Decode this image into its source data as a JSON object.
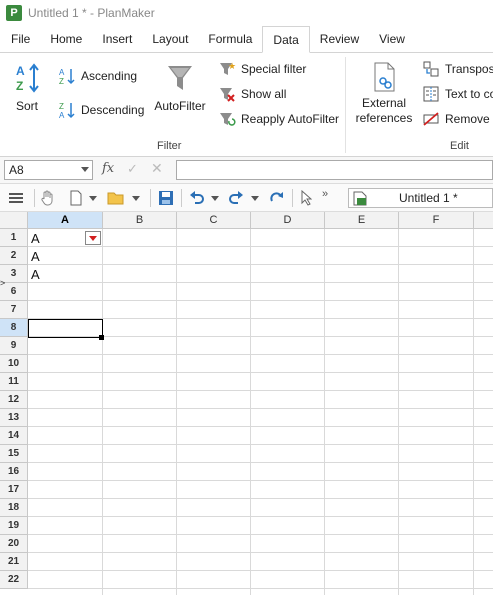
{
  "window": {
    "title": "Untitled 1 * - PlanMaker",
    "app_icon": "P"
  },
  "ribbon_tabs": [
    "File",
    "Home",
    "Insert",
    "Layout",
    "Formula",
    "Data",
    "Review",
    "View"
  ],
  "active_tab": "Data",
  "ribbon": {
    "sort_label": "Sort",
    "ascending_label": "Ascending",
    "descending_label": "Descending",
    "autofilter_label": "AutoFilter",
    "special_filter_label": "Special filter",
    "show_all_label": "Show all",
    "reapply_label": "Reapply AutoFilter",
    "filter_group": "Filter",
    "external_refs_line1": "External",
    "external_refs_line2": "references",
    "transpose_label": "Transpos",
    "text_to_label": "Text to co",
    "remove_label": "Remove d",
    "edit_group": "Edit"
  },
  "formula_bar": {
    "cell_ref": "A8",
    "fx": "fx",
    "value": ""
  },
  "document": {
    "title": "Untitled 1 *"
  },
  "sheet": {
    "columns": [
      "A",
      "B",
      "C",
      "D",
      "E",
      "F"
    ],
    "selected_column": "A",
    "rows": [
      "1",
      "2",
      "3",
      "6",
      "7",
      "8",
      "9",
      "10",
      "11",
      "12",
      "13",
      "14",
      "15",
      "16",
      "17",
      "18",
      "19",
      "20",
      "21",
      "22"
    ],
    "selected_row": "8",
    "cells": {
      "A1": "A",
      "A2": "A",
      "A3": "A"
    }
  },
  "colors": {
    "accent": "#3b8a3e",
    "selection_header": "#cfe3f7",
    "filter_arrow": "#d21f1f"
  }
}
